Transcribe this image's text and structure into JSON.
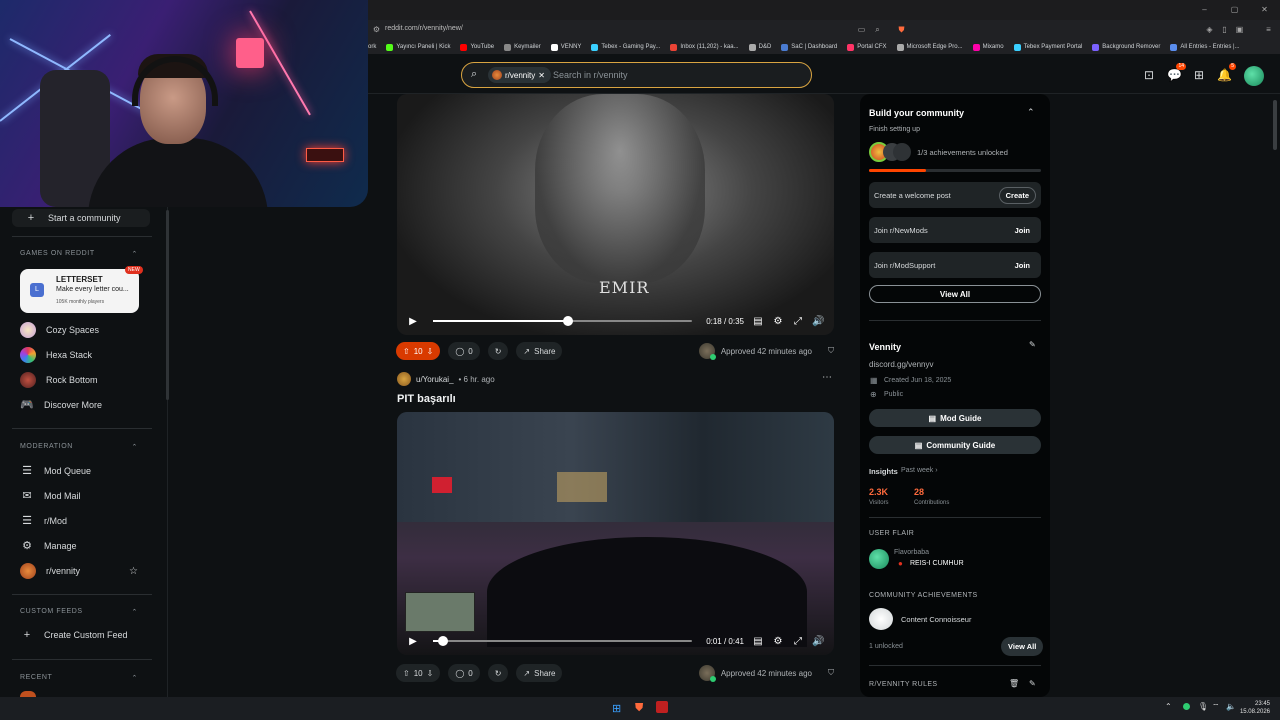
{
  "browser": {
    "url": "reddit.com/r/vennity/new/",
    "bookmarks": [
      "ork",
      "Yayıncı Paneli | Kick",
      "YouTube",
      "Keymailer",
      "VENNY",
      "Tebex - Gaming Pay...",
      "Inbox (11,202) - kaa...",
      "D&D",
      "SaC | Dashboard",
      "Portal CFX",
      "Microsoft Edge Pro...",
      "Mixamo",
      "Tebex Payment Portal",
      "Background Remover",
      "All Entries - Entries |..."
    ]
  },
  "header": {
    "search_chip": "r/vennity",
    "search_placeholder": "Search in r/vennity",
    "chat_badge": "14",
    "notif_badge": "5"
  },
  "sidebar": {
    "start_community": "Start a community",
    "games_heading": "GAMES ON REDDIT",
    "game_card": {
      "title": "LETTERSET",
      "desc": "Make every letter cou...",
      "players": "105K monthly players",
      "badge": "NEW"
    },
    "games": [
      "Cozy Spaces",
      "Hexa Stack",
      "Rock Bottom"
    ],
    "discover": "Discover More",
    "moderation_heading": "MODERATION",
    "moderation": [
      "Mod Queue",
      "Mod Mail",
      "r/Mod",
      "Manage",
      "r/vennity"
    ],
    "custom_feeds_heading": "CUSTOM FEEDS",
    "create_feed": "Create Custom Feed",
    "recent_heading": "RECENT"
  },
  "posts": [
    {
      "video_overlay_text": "EMIR",
      "time": "0:18 / 0:35",
      "progress": 0.52,
      "votes": "10",
      "comments": "0",
      "share": "Share",
      "approved": "Approved 42 minutes ago",
      "upvoted": true
    },
    {
      "author": "u/Yorukai_",
      "age": "• 6 hr. ago",
      "title": "PIT başarılı",
      "time": "0:01 / 0:41",
      "progress": 0.04,
      "votes": "10",
      "comments": "0",
      "share": "Share",
      "approved": "Approved 42 minutes ago",
      "upvoted": false
    }
  ],
  "right_sidebar": {
    "build_title": "Build your community",
    "finish_setup": "Finish setting up",
    "achievements_progress": "1/3 achievements unlocked",
    "tasks": [
      {
        "label": "Create a welcome post",
        "action": "Create"
      },
      {
        "label": "Join r/NewMods",
        "action": "Join"
      },
      {
        "label": "Join r/ModSupport",
        "action": "Join"
      }
    ],
    "view_all": "View All",
    "community_name": "Vennity",
    "community_link": "discord.gg/vennyv",
    "created": "Created Jun 18, 2025",
    "visibility": "Public",
    "mod_guide": "Mod Guide",
    "community_guide": "Community Guide",
    "insights": "Insights",
    "insights_period": "Past week ›",
    "visitors_value": "2.3K",
    "visitors_label": "Visitors",
    "contrib_value": "28",
    "contrib_label": "Contributions",
    "user_flair_heading": "USER FLAIR",
    "flair_user": "Flavorbaba",
    "flair_text": "REIS-I CUMHUR",
    "achievements_heading": "COMMUNITY ACHIEVEMENTS",
    "achievement": "Content Connoisseur",
    "unlocked": "1 unlocked",
    "view_all_2": "View All",
    "rules_heading": "R/VENNITY RULES"
  },
  "taskbar": {
    "time": "23:45",
    "date": "15.08.2026"
  },
  "colors": {
    "accent": "#ff4500",
    "upvote": "#d93a00",
    "search_border": "#d9a441"
  }
}
